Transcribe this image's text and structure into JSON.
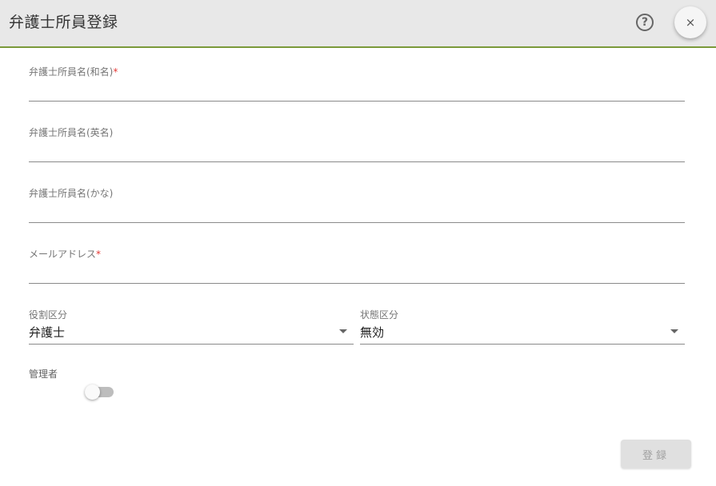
{
  "header": {
    "title": "弁護士所員登録",
    "help_icon": "?",
    "close_icon": "×"
  },
  "form": {
    "name_ja": {
      "label": "弁護士所員名(和名)",
      "required_mark": "*",
      "value": ""
    },
    "name_en": {
      "label": "弁護士所員名(英名)",
      "value": ""
    },
    "name_kana": {
      "label": "弁護士所員名(かな)",
      "value": ""
    },
    "email": {
      "label": "メールアドレス",
      "required_mark": "*",
      "value": ""
    },
    "role": {
      "label": "役割区分",
      "value": "弁護士"
    },
    "status": {
      "label": "状態区分",
      "value": "無効"
    },
    "admin": {
      "label": "管理者",
      "checked": false
    }
  },
  "actions": {
    "submit_label": "登録"
  },
  "colors": {
    "accent_line": "#7a9a3a",
    "required": "#e53935"
  }
}
